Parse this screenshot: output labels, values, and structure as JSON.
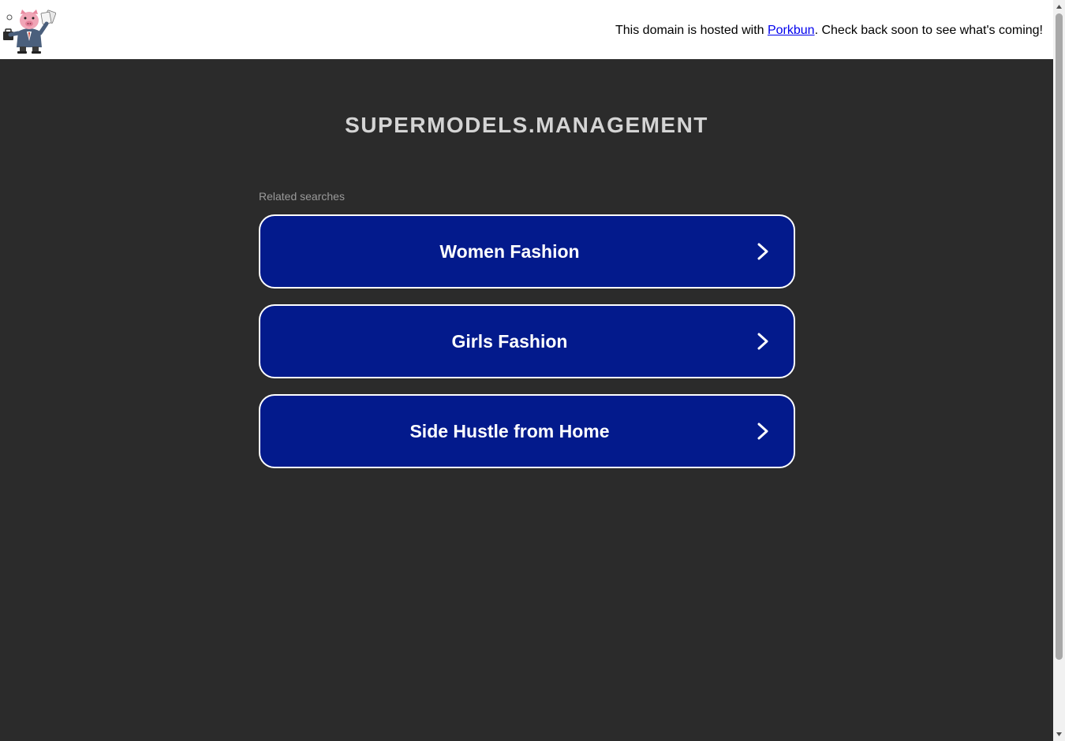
{
  "header": {
    "logo_icon": "pig-businessman-icon",
    "hosted_prefix": "This domain is hosted with ",
    "hosted_link": "Porkbun",
    "hosted_suffix": ". Check back soon to see what's coming!"
  },
  "main": {
    "domain_title": "SUPERMODELS.MANAGEMENT",
    "related_label": "Related searches",
    "searches": [
      {
        "label": "Women Fashion",
        "icon": "chevron-right-icon"
      },
      {
        "label": "Girls Fashion",
        "icon": "chevron-right-icon"
      },
      {
        "label": "Side Hustle from Home",
        "icon": "chevron-right-icon"
      }
    ]
  },
  "colors": {
    "background": "#2b2b2b",
    "topbar": "#ffffff",
    "button_bg": "#031a8c",
    "button_border": "#ffffff",
    "title": "#d4d4d4",
    "link": "#0000ee"
  }
}
